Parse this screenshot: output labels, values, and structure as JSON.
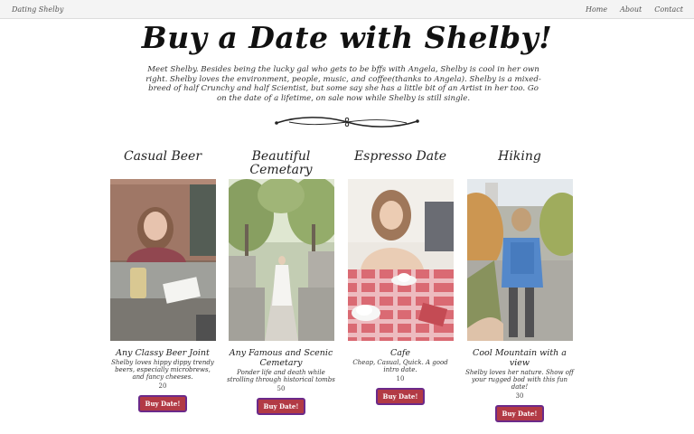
{
  "navbar": {
    "brand": "Dating Shelby",
    "links": [
      "Home",
      "About",
      "Contact"
    ]
  },
  "page_title": "Buy a Date with Shelby!",
  "intro": "Meet Shelby. Besides being the lucky gal who gets to be bffs with Angela, Shelby is cool in her own right. Shelby loves the environment, people, music, and coffee(thanks to Angela). Shelby is a mixed-breed of half Crunchy and half Scientist, but some say she has a little bit of an Artist in her too. Go on the date of a lifetime, on sale now while Shelby is still single.",
  "cards": [
    {
      "heading": "Casual Beer",
      "photo": "beer-photo",
      "title": "Any Classy Beer Joint",
      "description": "Shelby loves hippy dippy trendy beers, especially microbrews, and fancy cheeses.",
      "price": "20",
      "button": "Buy Date!"
    },
    {
      "heading": "Beautiful Cemetary",
      "photo": "cemetery-photo",
      "title": "Any Famous and Scenic Cemetary",
      "description": "Ponder life and death while strolling through historical tombs",
      "price": "50",
      "button": "Buy Date!"
    },
    {
      "heading": "Espresso Date",
      "photo": "espresso-photo",
      "title": "Cafe",
      "description": "Cheap, Casual, Quick. A good intro date.",
      "price": "10",
      "button": "Buy Date!"
    },
    {
      "heading": "Hiking",
      "photo": "hiking-photo",
      "title": "Cool Mountain with a view",
      "description": "Shelby loves her nature. Show off your rugged bod with this fun date!",
      "price": "30",
      "button": "Buy Date!"
    }
  ],
  "colors": {
    "button": "#b23a45",
    "button_border": "#6b2a8a",
    "navbar": "#f4f4f4"
  }
}
